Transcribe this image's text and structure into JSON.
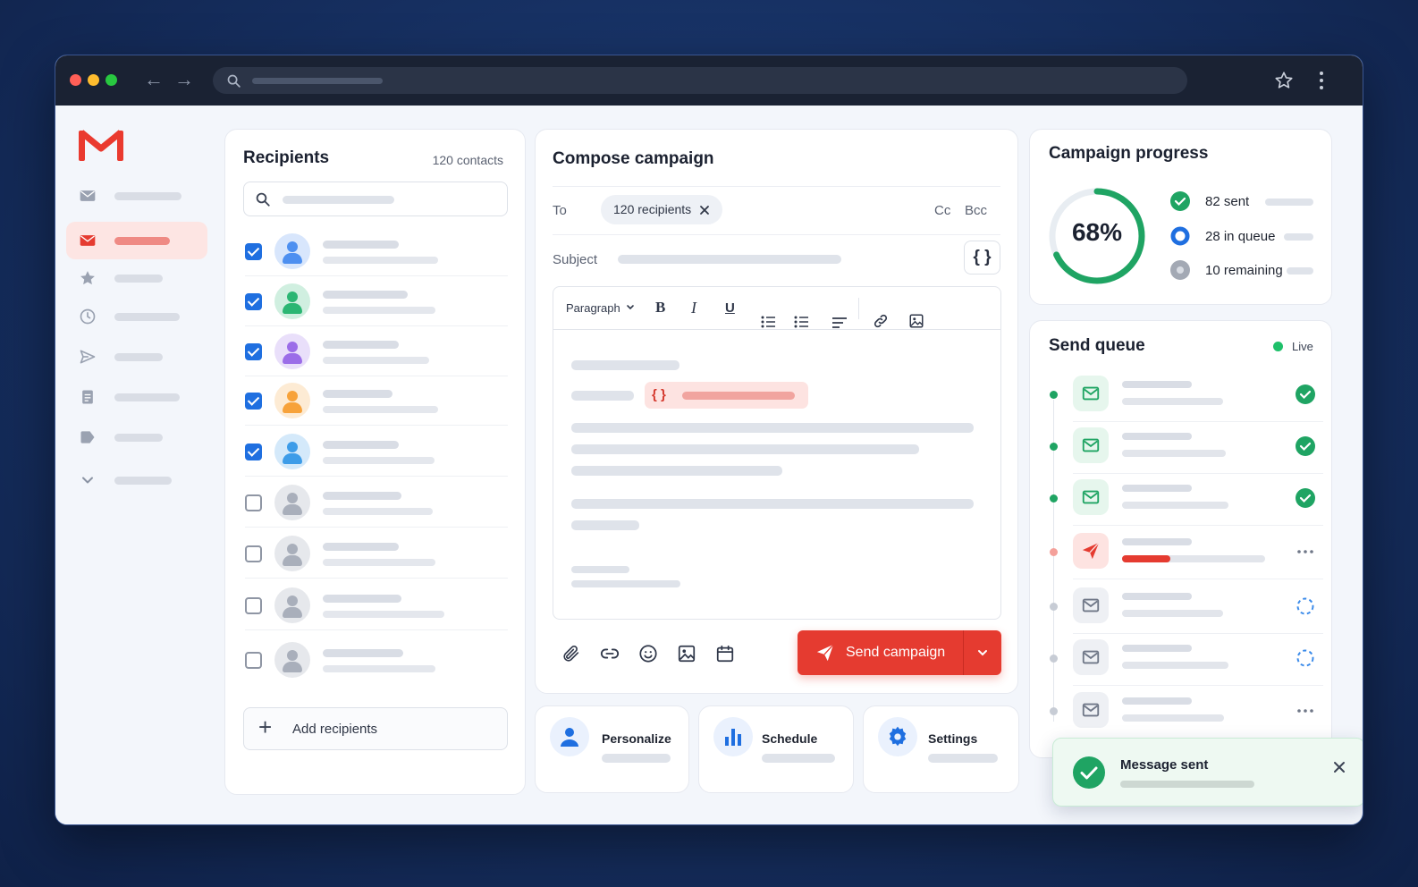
{
  "brand": {
    "accent": "#ea3a2f",
    "primary": "#1f6fe0",
    "success": "#1fa463"
  },
  "browser": {
    "icons": [
      "back-arrow-icon",
      "forward-arrow-icon",
      "search-icon",
      "star-icon",
      "more-vertical-icon"
    ]
  },
  "sidebar": {
    "icons": [
      "inbox-icon",
      "mail-icon",
      "star-icon",
      "clock-icon",
      "send-icon",
      "document-icon",
      "label-icon",
      "chevron-down-icon"
    ]
  },
  "recipients": {
    "title": "Recipients",
    "count": "120 contacts",
    "add_label": "Add recipients",
    "rows": [
      {
        "checked": true,
        "color": "#4d8ff0"
      },
      {
        "checked": true,
        "color": "#2bb673"
      },
      {
        "checked": true,
        "color": "#9b6de8"
      },
      {
        "checked": true,
        "color": "#f7a23a"
      },
      {
        "checked": true,
        "color": "#3d9ce8"
      },
      {
        "checked": false,
        "color": "#a9afbb"
      },
      {
        "checked": false,
        "color": "#a9afbb"
      },
      {
        "checked": false,
        "color": "#a9afbb"
      },
      {
        "checked": false,
        "color": "#a9afbb"
      }
    ]
  },
  "compose": {
    "title": "Compose campaign",
    "to_label": "To",
    "recipients_chip": "120 recipients",
    "cc": "Cc",
    "bcc": "Bcc",
    "subject_label": "Subject",
    "variable_button": "{ }",
    "paragraph": "Paragraph",
    "bold": "B",
    "italic": "I",
    "underline": "U",
    "variable_tag": "{ }",
    "send_button": "Send campaign"
  },
  "actions": [
    {
      "label": "Personalize",
      "icon": "person-icon"
    },
    {
      "label": "Schedule",
      "icon": "bar-chart-icon"
    },
    {
      "label": "Settings",
      "icon": "gear-icon"
    }
  ],
  "progress": {
    "title": "Campaign progress",
    "percent_label": "68%",
    "percent": 68,
    "sent": "82 sent",
    "queue": "28 in queue",
    "remaining": "10 remaining"
  },
  "queue": {
    "title": "Send queue",
    "live": "Live",
    "items": [
      {
        "state": "sent"
      },
      {
        "state": "sent"
      },
      {
        "state": "sent"
      },
      {
        "state": "sending",
        "progress": 0.34
      },
      {
        "state": "pending"
      },
      {
        "state": "pending"
      },
      {
        "state": "waiting"
      }
    ]
  },
  "toast": {
    "title": "Message sent"
  }
}
